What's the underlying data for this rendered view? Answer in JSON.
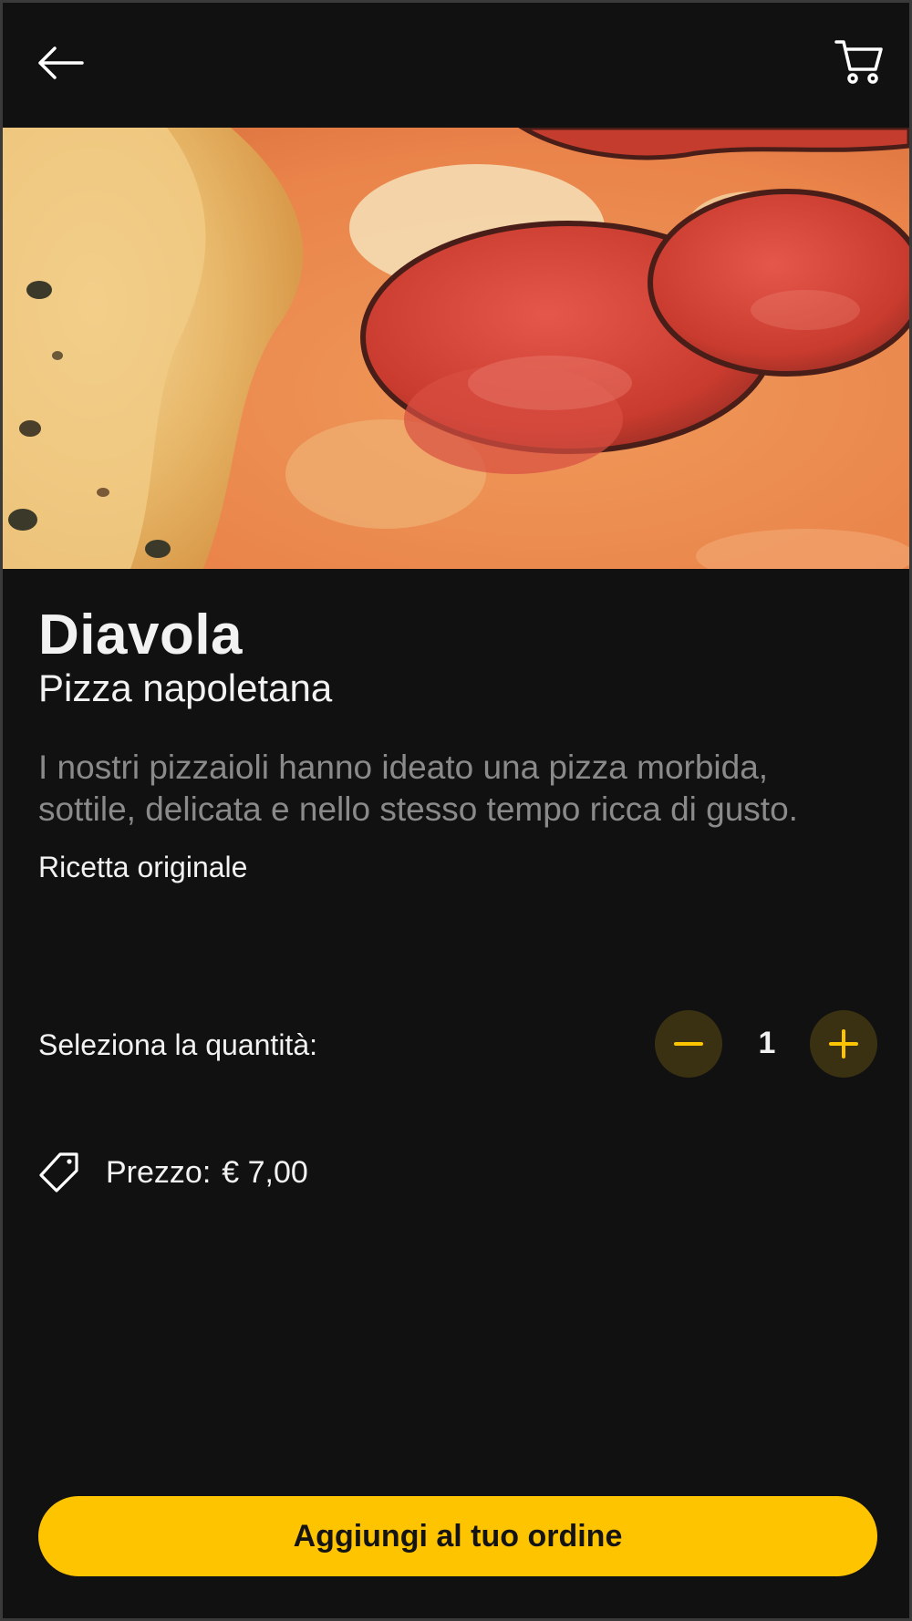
{
  "header": {
    "back_icon": "arrow-left-icon",
    "cart_icon": "cart-icon"
  },
  "hero": {
    "image": "pizza-diavola-photo"
  },
  "product": {
    "name": "Diavola",
    "category": "Pizza napoletana",
    "description": "I nostri pizzaioli hanno ideato una pizza morbida, sottile, delicata e nello stesso tempo ricca di gusto.",
    "note": "Ricetta originale"
  },
  "quantity": {
    "label": "Seleziona la quantità:",
    "value": "1",
    "minus_icon": "minus-icon",
    "plus_icon": "plus-icon"
  },
  "price": {
    "icon": "tag-icon",
    "label": "Prezzo:",
    "value": "€ 7,00"
  },
  "cta": {
    "label": "Aggiungi al tuo ordine"
  },
  "colors": {
    "background": "#111111",
    "accent": "#ffc400",
    "stepper_bg": "#3a3112",
    "muted_text": "#8a8a8a"
  }
}
